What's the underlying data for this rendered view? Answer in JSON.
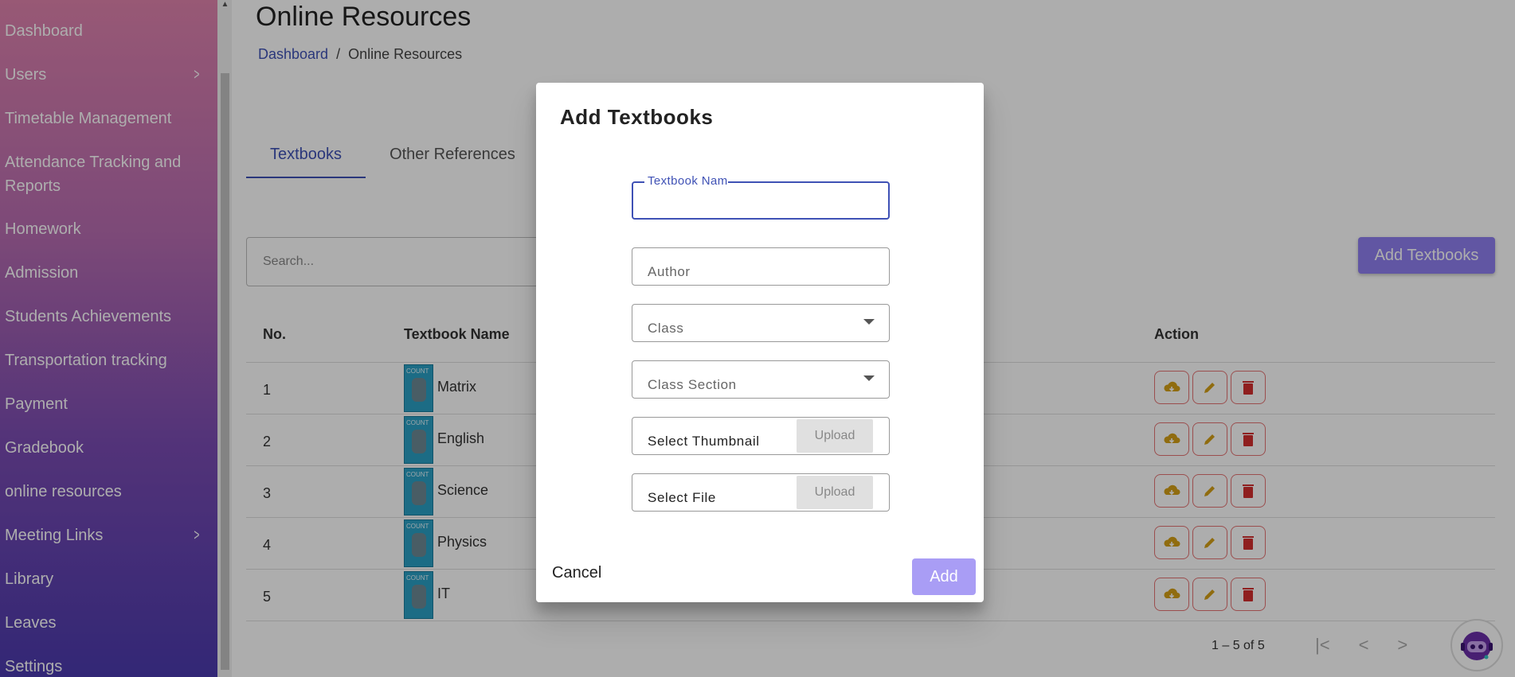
{
  "sidebar": {
    "items": [
      {
        "label": "Dashboard",
        "chevron": false
      },
      {
        "label": "Users",
        "chevron": true
      },
      {
        "label": "Timetable Management",
        "chevron": false
      },
      {
        "label": "Attendance Tracking and",
        "label2": "Reports",
        "chevron": false
      },
      {
        "label": "Homework",
        "chevron": false
      },
      {
        "label": "Admission",
        "chevron": false
      },
      {
        "label": "Students Achievements",
        "chevron": false
      },
      {
        "label": "Transportation tracking",
        "chevron": false
      },
      {
        "label": "Payment",
        "chevron": false
      },
      {
        "label": "Gradebook",
        "chevron": false
      },
      {
        "label": "online resources",
        "chevron": false
      },
      {
        "label": "Meeting Links",
        "chevron": true
      },
      {
        "label": "Library",
        "chevron": false
      },
      {
        "label": "Leaves",
        "chevron": false
      },
      {
        "label": "Settings",
        "chevron": false
      }
    ]
  },
  "header": {
    "title": "Online Resources",
    "breadcrumb": {
      "root": "Dashboard",
      "sep": "/",
      "current": "Online Resources"
    }
  },
  "tabs": [
    {
      "label": "Textbooks",
      "active": true
    },
    {
      "label": "Other References",
      "active": false
    }
  ],
  "search": {
    "placeholder": "Search..."
  },
  "add_button": "Add Textbooks",
  "table": {
    "columns": {
      "no": "No.",
      "name": "Textbook Name",
      "action": "Action"
    },
    "rows": [
      {
        "no": "1",
        "name": "Matrix"
      },
      {
        "no": "2",
        "name": "English"
      },
      {
        "no": "3",
        "name": "Science"
      },
      {
        "no": "4",
        "name": "Physics"
      },
      {
        "no": "5",
        "name": "IT"
      }
    ]
  },
  "pagination": {
    "range": "1 – 5 of 5"
  },
  "dialog": {
    "title": "Add Textbooks",
    "fields": {
      "textbook_name": {
        "label": "Textbook Name",
        "value": ""
      },
      "author": "Author",
      "class": "Class",
      "class_section": "Class Section",
      "thumbnail": "Select Thumbnail",
      "file": "Select File"
    },
    "upload_label": "Upload",
    "cancel": "Cancel",
    "add": "Add"
  },
  "colors": {
    "primary": "#3f51b5",
    "accent_button": "#8f7ff0",
    "danger": "#d32f2f",
    "warn": "#d4a017"
  }
}
